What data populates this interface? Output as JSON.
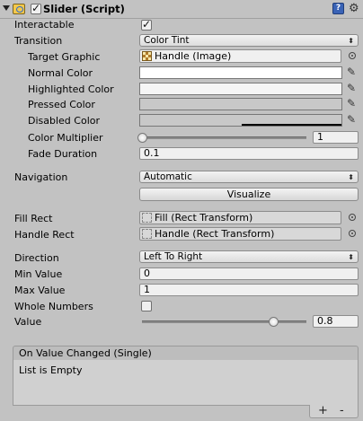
{
  "component": {
    "title": "Slider (Script)",
    "enabled": true
  },
  "transition_section": {
    "interactable_label": "Interactable",
    "interactable_checked": true,
    "transition_label": "Transition",
    "transition_value": "Color Tint",
    "target_graphic_label": "Target Graphic",
    "target_graphic_value": "Handle (Image)",
    "normal_color_label": "Normal Color",
    "normal_color": "#ffffff",
    "highlighted_color_label": "Highlighted Color",
    "highlighted_color": "#f5f5f5",
    "pressed_color_label": "Pressed Color",
    "pressed_color": "#c8c8c8",
    "disabled_color_label": "Disabled Color",
    "disabled_color": "#c8c8c8",
    "color_multiplier_label": "Color Multiplier",
    "color_multiplier_value": "1",
    "fade_duration_label": "Fade Duration",
    "fade_duration_value": "0.1"
  },
  "navigation_section": {
    "navigation_label": "Navigation",
    "navigation_value": "Automatic",
    "visualize_button": "Visualize"
  },
  "rects": {
    "fill_rect_label": "Fill Rect",
    "fill_rect_value": "Fill (Rect Transform)",
    "handle_rect_label": "Handle Rect",
    "handle_rect_value": "Handle (Rect Transform)"
  },
  "slider_settings": {
    "direction_label": "Direction",
    "direction_value": "Left To Right",
    "min_value_label": "Min Value",
    "min_value": "0",
    "max_value_label": "Max Value",
    "max_value": "1",
    "whole_numbers_label": "Whole Numbers",
    "whole_numbers_checked": false,
    "value_label": "Value",
    "value": "0.8"
  },
  "events": {
    "on_value_changed_title": "On Value Changed (Single)",
    "list_empty_text": "List is Empty",
    "add_label": "+",
    "remove_label": "-"
  },
  "icons": {
    "help": "help-book-icon",
    "settings": "gear-icon"
  }
}
